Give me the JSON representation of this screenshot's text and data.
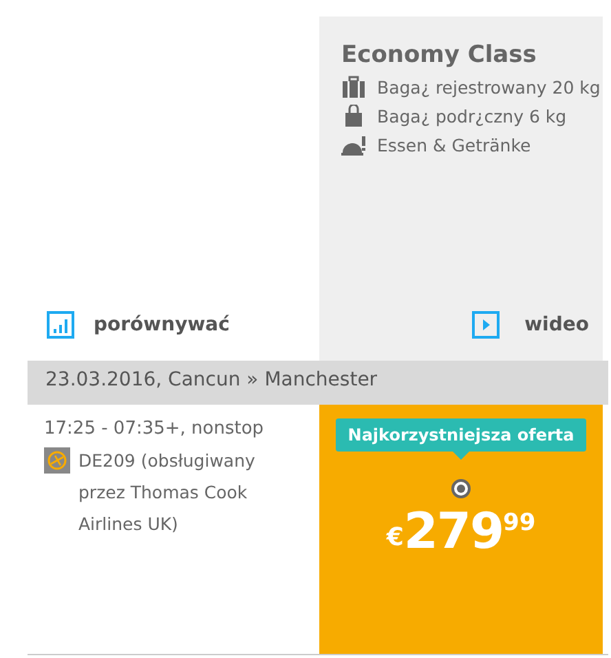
{
  "fare": {
    "title": "Economy Class",
    "features": [
      {
        "kind": "suitcase",
        "text": "Baga¿ rejestrowany 20 kg"
      },
      {
        "kind": "bag",
        "text": "Baga¿ podr¿czny 6 kg"
      },
      {
        "kind": "meal",
        "text": "Essen & Getränke"
      }
    ],
    "video_link": "wideo"
  },
  "compare_link": "porównywać",
  "segment": {
    "header": "23.03.2016, Cancun » Manchester",
    "times": "17:25 - 07:35+, nonstop",
    "flight": "DE209",
    "operator": "(obsługiwany przez Thomas Cook Airlines UK)"
  },
  "offer": {
    "badge": "Najkorzystniejsza oferta",
    "selected": true,
    "currency": "€",
    "amount": "279",
    "cents": "99"
  }
}
